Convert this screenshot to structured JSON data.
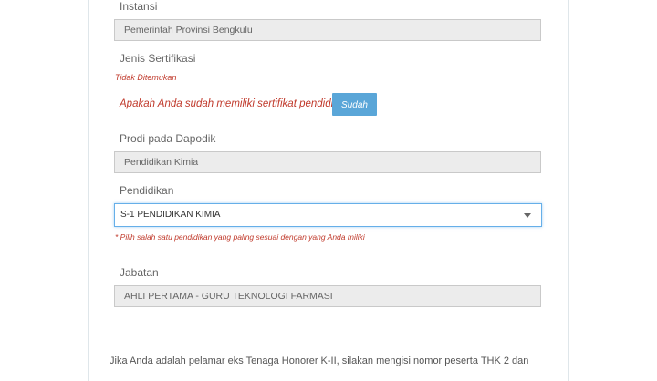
{
  "instansi": {
    "label": "Instansi",
    "value": "Pemerintah Provinsi Bengkulu"
  },
  "jenis_sertifikasi": {
    "label": "Jenis Sertifikasi",
    "status": "Tidak Ditemukan",
    "question": "Apakah Anda sudah memiliki sertifikat pendidik?",
    "button": "Sudah"
  },
  "prodi": {
    "label": "Prodi pada Dapodik",
    "value": "Pendidikan Kimia"
  },
  "pendidikan": {
    "label": "Pendidikan",
    "selected": "S-1 PENDIDIKAN KIMIA",
    "hint": "* Pilih salah satu pendidikan yang paling sesuai dengan yang Anda miliki"
  },
  "jabatan": {
    "label": "Jabatan",
    "value": "AHLI PERTAMA - GURU TEKNOLOGI FARMASI"
  },
  "footer_text": "Jika Anda adalah pelamar eks Tenaga Honorer K-II, silakan mengisi nomor peserta THK 2 dan",
  "colors": {
    "button": "#5aa6d8",
    "error": "#c0392b",
    "focus_border": "#66afe9"
  }
}
